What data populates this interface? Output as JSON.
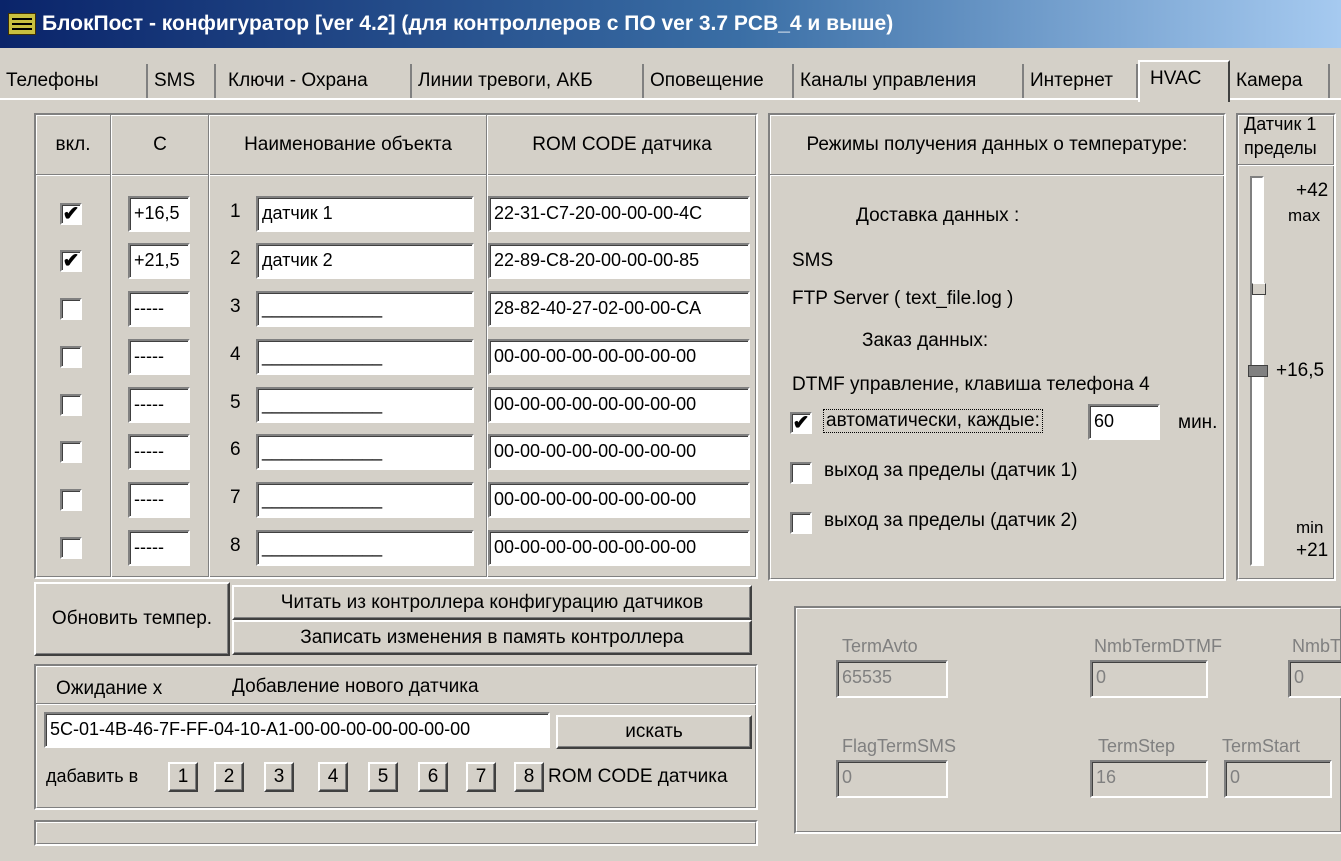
{
  "window": {
    "title": "БлокПост - конфигуратор [ver 4.2] (для контроллеров с ПО ver 3.7  PCB_4 и выше)"
  },
  "tabs": [
    "Телефоны",
    "SMS",
    "Ключи - Охрана",
    "Линии тревоги, АКБ",
    "Оповещение",
    "Каналы управления",
    "Интернет",
    "HVAC",
    "Камера"
  ],
  "active_tab": "HVAC",
  "sensor_table": {
    "headers": {
      "enabled": "вкл.",
      "temp": "C",
      "name": "Наименование объекта",
      "rom": "ROM CODE датчика"
    },
    "rows": [
      {
        "on": "✔",
        "temp": "+16,5",
        "num": "1",
        "name": "датчик 1",
        "rom": "22-31-C7-20-00-00-00-4C"
      },
      {
        "on": "✔",
        "temp": "+21,5",
        "num": "2",
        "name": "датчик 2",
        "rom": "22-89-C8-20-00-00-00-85"
      },
      {
        "on": "",
        "temp": "-----",
        "num": "3",
        "name": "____________",
        "rom": "28-82-40-27-02-00-00-CA"
      },
      {
        "on": "",
        "temp": "-----",
        "num": "4",
        "name": "____________",
        "rom": "00-00-00-00-00-00-00-00"
      },
      {
        "on": "",
        "temp": "-----",
        "num": "5",
        "name": "____________",
        "rom": "00-00-00-00-00-00-00-00"
      },
      {
        "on": "",
        "temp": "-----",
        "num": "6",
        "name": "____________",
        "rom": "00-00-00-00-00-00-00-00"
      },
      {
        "on": "",
        "temp": "-----",
        "num": "7",
        "name": "____________",
        "rom": "00-00-00-00-00-00-00-00"
      },
      {
        "on": "",
        "temp": "-----",
        "num": "8",
        "name": "____________",
        "rom": "00-00-00-00-00-00-00-00"
      }
    ]
  },
  "buttons": {
    "refresh": "Обновить темпер.",
    "read": "Читать из контроллера конфигурацию датчиков",
    "write": "Записать изменения в память контроллера",
    "search": "искать"
  },
  "add_sensor": {
    "waiting": "Ожидание x",
    "title": "Добавление нового датчика",
    "code": "5C-01-4B-46-7F-FF-04-10-A1-00-00-00-00-00-00-00",
    "add_to": "дабавить в",
    "slots": [
      "1",
      "2",
      "3",
      "4",
      "5",
      "6",
      "7",
      "8"
    ],
    "suffix": "ROM CODE датчика"
  },
  "modes": {
    "title": "Режимы получения данных о температуре:",
    "delivery": "Доставка данных :",
    "sms": "SMS",
    "ftp": "FTP Server ( text_file.log )",
    "order": "Заказ данных:",
    "dtmf": "DTMF  управление, клавиша телефона 4",
    "auto": {
      "checked": "✔",
      "label": "автоматически, каждые:",
      "value": "60",
      "unit": "мин."
    },
    "out1": {
      "checked": "",
      "label": "выход за пределы (датчик 1)"
    },
    "out2": {
      "checked": "",
      "label": "выход за пределы (датчик 2)"
    }
  },
  "limits": {
    "title1": "Датчик 1",
    "title2": "пределы",
    "max_val": "+42",
    "max": "max",
    "current": "+16,5",
    "min": "min",
    "min_val": "+21",
    "max_fraction": 0.72,
    "current_fraction": 0.5
  },
  "debug": {
    "term_avto": {
      "label": "TermAvto",
      "value": "65535"
    },
    "nmb_term_dtmf": {
      "label": "NmbTermDTMF",
      "value": "0"
    },
    "nmb_t": {
      "label": "NmbT",
      "value": "0"
    },
    "flag_term_sms": {
      "label": "FlagTermSMS",
      "value": "0"
    },
    "term_step": {
      "label": "TermStep",
      "value": "16"
    },
    "term_start": {
      "label": "TermStart",
      "value": "0"
    }
  }
}
